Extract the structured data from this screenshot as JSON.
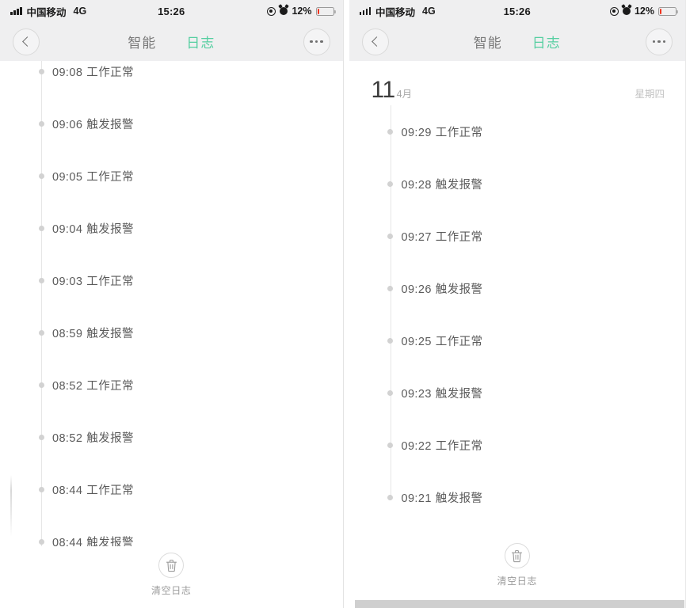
{
  "status_bar": {
    "carrier": "中国移动",
    "network": "4G",
    "time": "15:26",
    "battery_percent": "12%",
    "battery_level": 12,
    "location_icon": "location-icon",
    "alarm_icon": "alarm-icon",
    "signal_icon": "signal-bars-icon"
  },
  "nav": {
    "back_icon": "chevron-left-icon",
    "more_icon": "more-options-icon",
    "tab_inactive": "智能",
    "tab_active": "日志",
    "active_color": "#56cfa1",
    "inactive_color": "#7a7a7a"
  },
  "bottom_bar": {
    "trash_icon": "trash-icon",
    "label": "清空日志"
  },
  "left_panel": {
    "log_entries": [
      {
        "time": "09:08",
        "event": "工作正常"
      },
      {
        "time": "09:06",
        "event": "触发报警"
      },
      {
        "time": "09:05",
        "event": "工作正常"
      },
      {
        "time": "09:04",
        "event": "触发报警"
      },
      {
        "time": "09:03",
        "event": "工作正常"
      },
      {
        "time": "08:59",
        "event": "触发报警"
      },
      {
        "time": "08:52",
        "event": "工作正常"
      },
      {
        "time": "08:52",
        "event": "触发报警"
      },
      {
        "time": "08:44",
        "event": "工作正常"
      },
      {
        "time": "08:44",
        "event": "触发报警"
      }
    ]
  },
  "right_panel": {
    "date": {
      "day": "11",
      "month": "4月",
      "weekday": "星期四"
    },
    "log_entries": [
      {
        "time": "09:29",
        "event": "工作正常"
      },
      {
        "time": "09:28",
        "event": "触发报警"
      },
      {
        "time": "09:27",
        "event": "工作正常"
      },
      {
        "time": "09:26",
        "event": "触发报警"
      },
      {
        "time": "09:25",
        "event": "工作正常"
      },
      {
        "time": "09:23",
        "event": "触发报警"
      },
      {
        "time": "09:22",
        "event": "工作正常"
      },
      {
        "time": "09:21",
        "event": "触发报警"
      }
    ]
  }
}
